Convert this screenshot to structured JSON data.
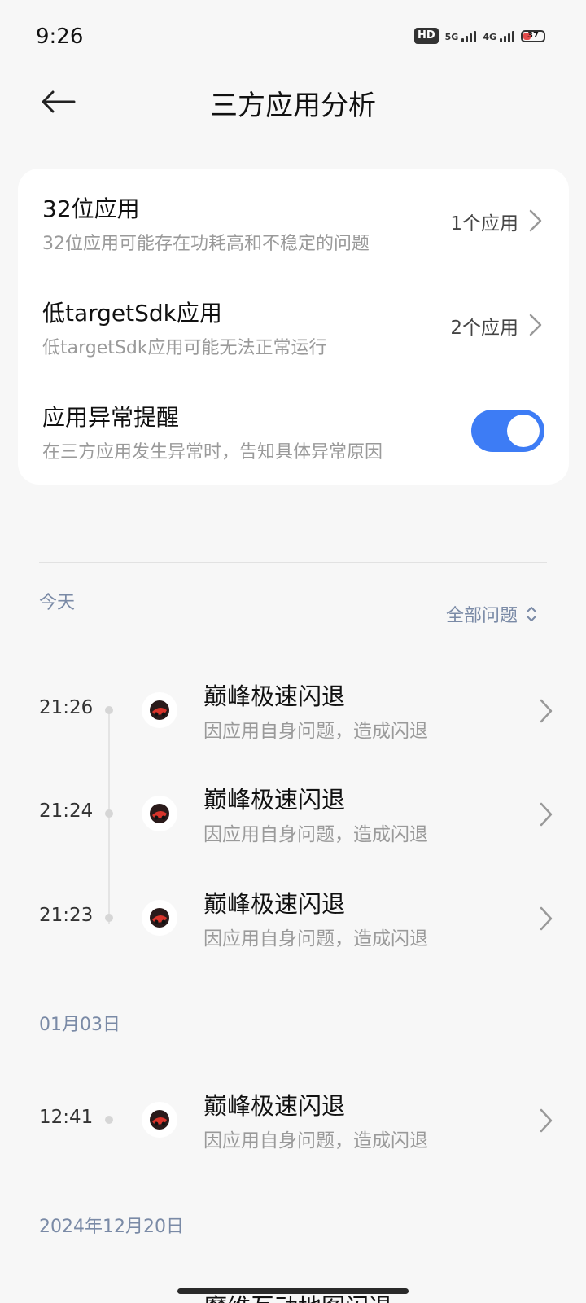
{
  "status_bar": {
    "time": "9:26",
    "hd_badge": "HD",
    "net1": "5G",
    "net2": "4G",
    "battery_level": "37",
    "battery_color": "#e24a4a"
  },
  "header": {
    "back_icon": "arrow-left-icon",
    "title": "三方应用分析"
  },
  "settings": {
    "rows": [
      {
        "title": "32位应用",
        "subtitle": "32位应用可能存在功耗高和不稳定的问题",
        "value": "1个应用"
      },
      {
        "title": "低targetSdk应用",
        "subtitle": "低targetSdk应用可能无法正常运行",
        "value": "2个应用"
      }
    ],
    "toggle_row": {
      "title": "应用异常提醒",
      "subtitle": "在三方应用发生异常时，告知具体异常原因",
      "enabled": true,
      "accent_color": "#3d7cf5"
    }
  },
  "history": {
    "filter_label": "全部问题",
    "sections": [
      {
        "label": "今天",
        "events": [
          {
            "time": "21:26",
            "title": "巅峰极速闪退",
            "subtitle": "因应用自身问题，造成闪退",
            "icon": "app-icon"
          },
          {
            "time": "21:24",
            "title": "巅峰极速闪退",
            "subtitle": "因应用自身问题，造成闪退",
            "icon": "app-icon"
          },
          {
            "time": "21:23",
            "title": "巅峰极速闪退",
            "subtitle": "因应用自身问题，造成闪退",
            "icon": "app-icon"
          }
        ]
      },
      {
        "label": "01月03日",
        "events": [
          {
            "time": "12:41",
            "title": "巅峰极速闪退",
            "subtitle": "因应用自身问题，造成闪退",
            "icon": "app-icon"
          }
        ]
      },
      {
        "label": "2024年12月20日",
        "events": [
          {
            "title": "魔维互动地图闪退"
          }
        ]
      }
    ]
  }
}
